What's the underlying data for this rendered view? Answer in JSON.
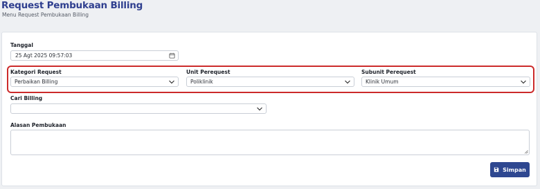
{
  "header": {
    "title": "Request Pembukaan Billing",
    "subtitle": "Menu Request Pembukaan Billing"
  },
  "form": {
    "tanggal": {
      "label": "Tanggal",
      "value": "25 Agt 2025 09:57:03",
      "icon": "calendar-icon"
    },
    "kategori_request": {
      "label": "Kategori Request",
      "value": "Perbaikan Billing",
      "icon": "chevron-down-icon"
    },
    "unit_perequest": {
      "label": "Unit Perequest",
      "value": "Poliklinik",
      "icon": "chevron-down-icon"
    },
    "subunit_perequest": {
      "label": "Subunit Perequest",
      "value": "Klinik Umum",
      "icon": "chevron-down-icon"
    },
    "cari_billing": {
      "label": "Cari Billing",
      "value": "",
      "icon": "chevron-down-icon"
    },
    "alasan_pembukaan": {
      "label": "Alasan Pembukaan",
      "value": ""
    }
  },
  "actions": {
    "save_label": "Simpan",
    "save_icon": "save-icon"
  },
  "colors": {
    "title": "#2f3f8f",
    "primary_button": "#2e4790",
    "highlight_border": "#cc2a2a",
    "background": "#eef0f3"
  }
}
